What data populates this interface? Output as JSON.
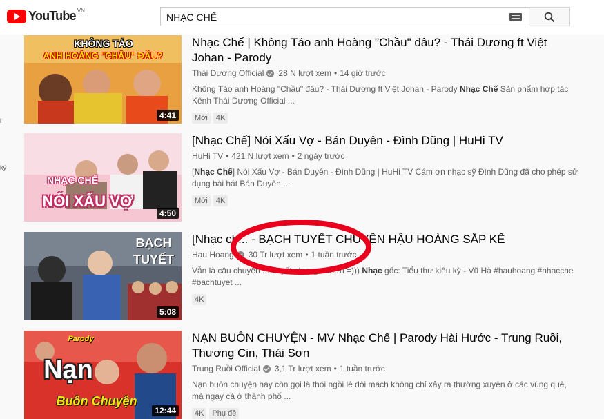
{
  "header": {
    "logo_text": "YouTube",
    "region": "VN",
    "search_value": "NHẠC CHẾ",
    "keyboard_icon": "keyboard-icon",
    "search_icon": "search-icon"
  },
  "side_fragments": [
    "i",
    "ký"
  ],
  "results": [
    {
      "title": "Nhạc Chế | Không Táo anh Hoàng \"Chầu\" đâu? - Thái Dương ft Việt Johan - Parody",
      "channel": "Thái Dương Official",
      "verified": true,
      "views": "28 N lượt xem",
      "age": "14 giờ trước",
      "desc_before": "Không Táo anh Hoàng \"Chầu\" đâu? - Thái Dương ft Việt Johan - Parody ",
      "desc_bold": "Nhạc Chế",
      "desc_after": " Sản phẩm hợp tác Kênh Thái Dương Official ...",
      "badges": [
        "Mới",
        "4K"
      ],
      "duration": "4:41",
      "thumb_text_top": "KHÔNG TÁO",
      "thumb_text_mid": "ANH HOÀNG \"CHẦU\" ĐÂU?"
    },
    {
      "title": "[Nhạc Chế] Nói Xấu Vợ - Bán Duyên - Đình Dũng | HuHi TV",
      "channel": "HuHi TV",
      "verified": false,
      "views": "421 N lượt xem",
      "age": "2 ngày trước",
      "desc_before": "[",
      "desc_bold": "Nhạc Chế",
      "desc_after": "] Nói Xấu Vợ - Bán Duyên - Đình Dũng | HuHi TV Cám ơn nhạc sỹ Đình Dũng đã cho phép sử dụng bài hát Bán Duyên ...",
      "badges": [
        "Mới",
        "4K"
      ],
      "duration": "4:50",
      "thumb_text_top": "NHẠC CHẾ",
      "thumb_text_mid": "NÓI XẤU VỢ"
    },
    {
      "title": "[Nhạc ch... - BẠCH TUYẾT CHUYỆN HẬU HOÀNG SẮP KẾ",
      "channel": "Hau Hoang",
      "verified": true,
      "views": "30 Tr lượt xem",
      "age": "1 tuần trước",
      "desc_before": "Vẫn là câu chuyện ... Tuyết phưng ... hơn =))) ",
      "desc_bold": "Nhạc",
      "desc_after": " gốc: Tiểu thư kiêu kỳ - Vũ Hà #hauhoang #nhacche #bachtuyet ...",
      "badges": [
        "4K"
      ],
      "duration": "5:08",
      "thumb_text_top": "BẠCH",
      "thumb_text_mid": "TUYẾT"
    },
    {
      "title": "NẠN BUÔN CHUYỆN - MV Nhạc Chế | Parody Hài Hước - Trung Ruồi, Thương Cin, Thái Sơn",
      "channel": "Trung Ruồi Official",
      "verified": true,
      "views": "3,1 Tr lượt xem",
      "age": "1 tuần trước",
      "desc_before": "Nạn buôn chuyện hay còn gọi là thói ngồi lê đôi mách không chỉ xảy ra thường xuyên ở các vùng quê, mà ngay cả ở thành phố ...",
      "desc_bold": "",
      "desc_after": "",
      "badges": [
        "4K",
        "Phụ đề"
      ],
      "duration": "12:44",
      "thumb_text_top": "Parody",
      "thumb_text_mid": "Nạn",
      "thumb_text_bot": "Buôn Chuyện"
    }
  ],
  "colors": {
    "brand_red": "#ff0000",
    "annotation_red": "#e8001c"
  }
}
